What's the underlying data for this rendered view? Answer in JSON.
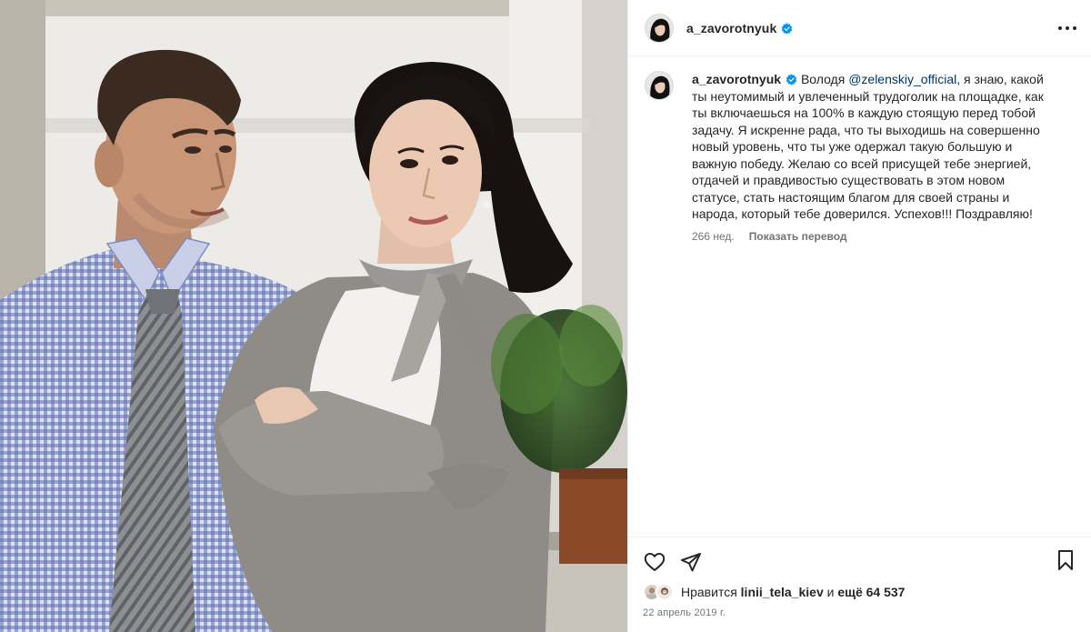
{
  "post": {
    "username": "a_zavorotnyuk",
    "verified": true,
    "caption": {
      "username": "a_zavorotnyuk",
      "text_before": "Володя ",
      "mention": "@zelenskiy_official",
      "text_after": ", я знаю, какой ты неутомимый и увлеченный трудоголик на площадке, как ты включаешься на 100% в каждую стоящую перед тобой задачу. Я искренне рада, что ты выходишь на совершенно новый уровень, что ты уже одержал такую большую и важную победу. Желаю со всей присущей тебе энергией, отдачей и правдивостью существовать в этом новом статусе, стать настоящим благом для своей страны и народа, который тебе доверился. Успехов!!! Поздравляю!",
      "age": "266 нед.",
      "translate_label": "Показать перевод"
    },
    "likes": {
      "prefix": "Нравится ",
      "user": "linii_tela_kiev",
      "middle": " и ",
      "count_text": "ещё 64 537"
    },
    "date": "22 апрель 2019 г."
  },
  "icons": {
    "more": "more-horizontal-icon",
    "like": "heart-outline-icon",
    "share": "paper-plane-icon",
    "save": "bookmark-icon",
    "verified": "verified-badge-icon"
  },
  "colors": {
    "text": "#262626",
    "secondary": "#737373",
    "mention": "#00376b",
    "verified": "#0095f6",
    "border": "#efefef"
  }
}
